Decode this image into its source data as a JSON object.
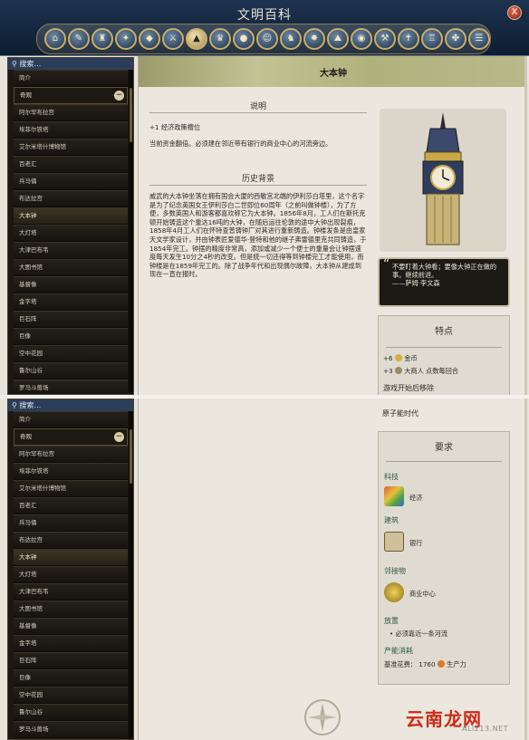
{
  "window": {
    "title": "文明百科",
    "close_label": "X"
  },
  "categories": [
    {
      "icon": "home-icon",
      "glyph": "⌂"
    },
    {
      "icon": "pedia-icon",
      "glyph": "✎"
    },
    {
      "icon": "policy-icon",
      "glyph": "♜"
    },
    {
      "icon": "religion-icon",
      "glyph": "✦"
    },
    {
      "icon": "tech-icon",
      "glyph": "◆"
    },
    {
      "icon": "unit-icon",
      "glyph": "⚔"
    },
    {
      "icon": "promotion-icon",
      "glyph": "▲"
    },
    {
      "icon": "wonder-icon",
      "glyph": "♛"
    },
    {
      "icon": "building-icon",
      "glyph": "●"
    },
    {
      "icon": "great-people-icon",
      "glyph": "☺"
    },
    {
      "icon": "civ-icon",
      "glyph": "♞"
    },
    {
      "icon": "city-state-icon",
      "glyph": "✸"
    },
    {
      "icon": "terrain-icon",
      "glyph": "⛰"
    },
    {
      "icon": "resource-icon",
      "glyph": "◉"
    },
    {
      "icon": "improvement-icon",
      "glyph": "⚒"
    },
    {
      "icon": "belief-icon",
      "glyph": "✝"
    },
    {
      "icon": "congress-icon",
      "glyph": "♖"
    },
    {
      "icon": "route-icon",
      "glyph": "✤"
    },
    {
      "icon": "concept-icon",
      "glyph": "☰"
    }
  ],
  "sidebar": {
    "search_label": "搜索…",
    "items": [
      {
        "label": "简介",
        "kind": "plain"
      },
      {
        "label": "奇观",
        "kind": "cat"
      },
      {
        "label": "阿尔罕布拉宫",
        "kind": "plain"
      },
      {
        "label": "埃菲尔铁塔",
        "kind": "plain"
      },
      {
        "label": "艾尔米塔什博物馆",
        "kind": "plain"
      },
      {
        "label": "百老汇",
        "kind": "plain"
      },
      {
        "label": "兵马俑",
        "kind": "plain"
      },
      {
        "label": "布达拉宫",
        "kind": "plain"
      },
      {
        "label": "大本钟",
        "kind": "selected"
      },
      {
        "label": "大灯塔",
        "kind": "plain"
      },
      {
        "label": "大津巴布韦",
        "kind": "plain"
      },
      {
        "label": "大图书馆",
        "kind": "plain"
      },
      {
        "label": "基督像",
        "kind": "plain"
      },
      {
        "label": "金字塔",
        "kind": "plain"
      },
      {
        "label": "巨石阵",
        "kind": "plain"
      },
      {
        "label": "巨像",
        "kind": "plain"
      },
      {
        "label": "空中花园",
        "kind": "plain"
      },
      {
        "label": "鲁尔山谷",
        "kind": "plain"
      },
      {
        "label": "罗马斗兽场",
        "kind": "plain"
      }
    ]
  },
  "article": {
    "name": "大本钟",
    "summary_heading": "说明",
    "summary_effect": "+1 经济政策槽位",
    "summary_text": "当前资金翻倍。必须建在邻近带有银行的商业中心的河流旁边。",
    "history_heading": "历史背景",
    "history_text": "威武的大本钟坐落在拥有国会大厦的西敏宫北端的伊利莎白塔里，这个名字是为了纪念英国女王伊利莎白二世即位60周年（之前叫做钟楼），为了方便，多数英国人和游客都喜欢称它为大本钟。1856年8月，工人们在斯托克顿开始铸造这个重达16吨的大钟，在随后运往伦敦的途中大钟出现裂痕，1858年4月工人们在怀特查普铸钟厂对其进行重新铸造。钟楼发条是由皇家天文学家设计，并由钟表匠爱德华·登特和他的继子弗雷德里克共同铸造，于1854年完工。钟摆的精度非常高，添加或减少一个便士的重量会让钟摆速度每天发生10分之4秒的改变。但是统一切还得等到钟楼完工才能使用，而钟楼是在1859年完工的。除了战争年代和出现偶尔故障，大本钟从建成到现在一直在报时。",
    "quote": "不要盯着大钟看；要像大钟正在做的事。继续前进。",
    "quote_author": "——萨姆·李文森"
  },
  "traits": {
    "heading": "特点",
    "rows": [
      {
        "value": "+6",
        "label": "金币",
        "icon": "gold-icon"
      },
      {
        "value": "+3",
        "label": "大商人 点数每回合",
        "icon": "great-merchant-icon"
      }
    ],
    "era_heading": "游戏开始后移除",
    "era": "原子能时代"
  },
  "requirements": {
    "heading": "要求",
    "tech_label": "科技",
    "tech_name": "经济",
    "building_label": "建筑",
    "building_name": "银行",
    "district_label": "邻接物",
    "district_name": "商业中心",
    "placement_label": "放置",
    "placement_text": "• 必须靠近一条河流",
    "cost_label": "产能消耗",
    "cost_text": "基准花费：",
    "cost_value": "1760",
    "cost_unit": "生产力"
  },
  "watermark": {
    "main": "云南龙网",
    "sub": "ALI213.NET"
  },
  "colors": {
    "header": "#1d3350",
    "accent_gold": "#c9ae68",
    "panel": "#ebe7df",
    "quote_bg": "#1c1a15"
  }
}
